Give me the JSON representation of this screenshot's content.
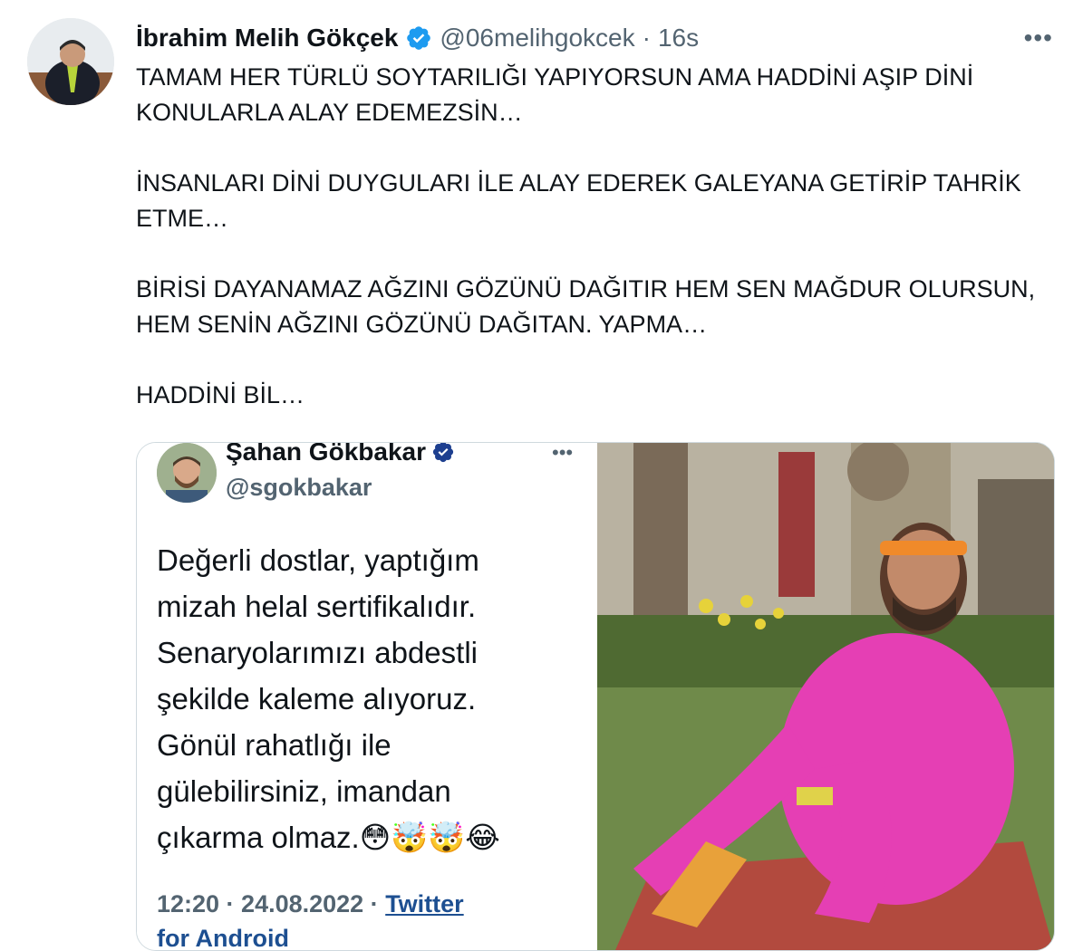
{
  "tweet": {
    "author_name": "İbrahim Melih Gökçek",
    "author_handle": "@06melihgokcek",
    "separator": "·",
    "time": "16s",
    "more_label": "•••",
    "paragraphs": [
      "TAMAM HER TÜRLÜ SOYTARILIĞI YAPIYORSUN AMA HADDİNİ AŞIP DİNİ KONULARLA ALAY EDEMEZSİN…",
      "İNSANLARI DİNİ DUYGULARI İLE ALAY EDEREK GALEYANA GETİRİP TAHRİK ETME…",
      "BİRİSİ DAYANAMAZ AĞZINI GÖZÜNÜ DAĞITIR HEM SEN MAĞDUR OLURSUN, HEM SENİN AĞZINI GÖZÜNÜ DAĞITAN. YAPMA…",
      "HADDİNİ BİL…"
    ]
  },
  "quoted_screenshot": {
    "name": "Şahan Gökbakar",
    "handle": "@sgokbakar",
    "more_label": "•••",
    "lines": [
      "Değerli dostlar, yaptığım",
      "mizah helal sertifikalıdır.",
      "Senaryolarımızı abdestli",
      "şekilde kaleme alıyoruz.",
      "Gönül rahatlığı ile",
      "gülebilirsiniz, imandan",
      "çıkarma olmaz.😳🤯🤯😂"
    ],
    "meta_time": "12:20 · 24.08.2022 · ",
    "meta_source": "Twitter",
    "meta_source_cont": "for Android"
  },
  "colors": {
    "verified": "#1d9bf0",
    "text": "#0f1419",
    "secondary": "#536471"
  }
}
